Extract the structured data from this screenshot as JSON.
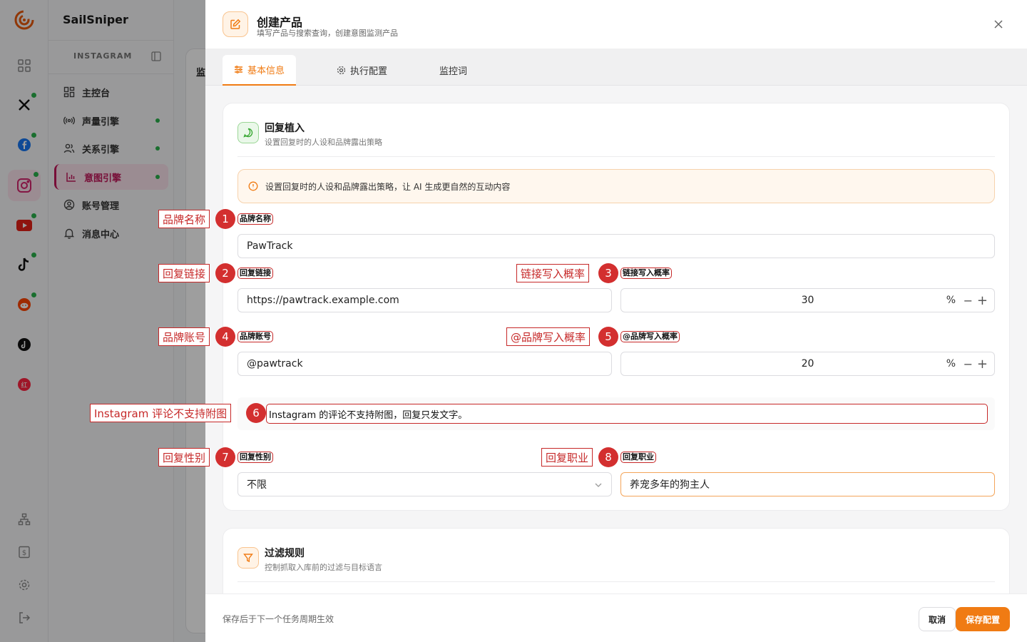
{
  "app": {
    "name": "SailSniper",
    "section": "INSTAGRAM"
  },
  "rail": {
    "icons": [
      "grid-icon",
      "x-icon",
      "facebook-icon",
      "instagram-icon",
      "youtube-icon",
      "tiktok-icon",
      "reddit-icon",
      "threads-icon",
      "xiaohongshu-icon"
    ],
    "bottom_icons": [
      "sitemap-icon",
      "billing-icon",
      "gear-icon",
      "logout-icon"
    ]
  },
  "sidebar": {
    "items": [
      {
        "label": "主控台",
        "icon": "dashboard-icon"
      },
      {
        "label": "声量引擎",
        "icon": "broadcast-icon"
      },
      {
        "label": "关系引擎",
        "icon": "users-icon"
      },
      {
        "label": "意图引擎",
        "icon": "chart-icon"
      },
      {
        "label": "账号管理",
        "icon": "account-icon"
      },
      {
        "label": "消息中心",
        "icon": "bell-icon"
      }
    ]
  },
  "background": {
    "title_fragment": "监"
  },
  "drawer": {
    "title": "创建产品",
    "subtitle": "填写产品与搜索查询，创建意图监测产品",
    "tabs": [
      {
        "label": "基本信息",
        "icon": "sliders-icon"
      },
      {
        "label": "执行配置",
        "icon": "gear-icon"
      },
      {
        "label": "监控词"
      }
    ],
    "card1": {
      "title": "回复植入",
      "subtitle": "设置回复时的人设和品牌露出策略",
      "notice": "设置回复时的人设和品牌露出策略，让 AI 生成更自然的互动内容",
      "fields": {
        "brand_name": {
          "label": "品牌名称",
          "value": "PawTrack"
        },
        "reply_link": {
          "label": "回复链接",
          "value": "https://pawtrack.example.com"
        },
        "link_prob": {
          "label": "链接写入概率",
          "value": "30",
          "unit": "%"
        },
        "brand_account": {
          "label": "品牌账号",
          "value": "@pawtrack"
        },
        "brand_prob": {
          "label": "@品牌写入概率",
          "value": "20",
          "unit": "%"
        },
        "instagram_tip": "Instagram 的评论不支持附图，回复只发文字。",
        "gender": {
          "label": "回复性别",
          "value": "不限"
        },
        "occupation": {
          "label": "回复职业",
          "value": "养宠多年的狗主人"
        }
      }
    },
    "card2": {
      "title": "过滤规则",
      "subtitle": "控制抓取入库前的过滤与目标语言"
    },
    "footer": {
      "note": "保存后于下一个任务周期生效",
      "cancel": "取消",
      "save": "保存配置"
    }
  },
  "annotations": [
    {
      "num": "1",
      "text": "品牌名称"
    },
    {
      "num": "2",
      "text": "回复链接"
    },
    {
      "num": "3",
      "text": "链接写入概率"
    },
    {
      "num": "4",
      "text": "品牌账号"
    },
    {
      "num": "5",
      "text": "@品牌写入概率"
    },
    {
      "num": "6",
      "text": "Instagram 评论不支持附图"
    },
    {
      "num": "7",
      "text": "回复性别"
    },
    {
      "num": "8",
      "text": "回复职业"
    }
  ],
  "colors": {
    "accent": "#f07b13",
    "active_nav": "#c2185b",
    "annotation": "#c62828",
    "online": "#2bb24c"
  }
}
